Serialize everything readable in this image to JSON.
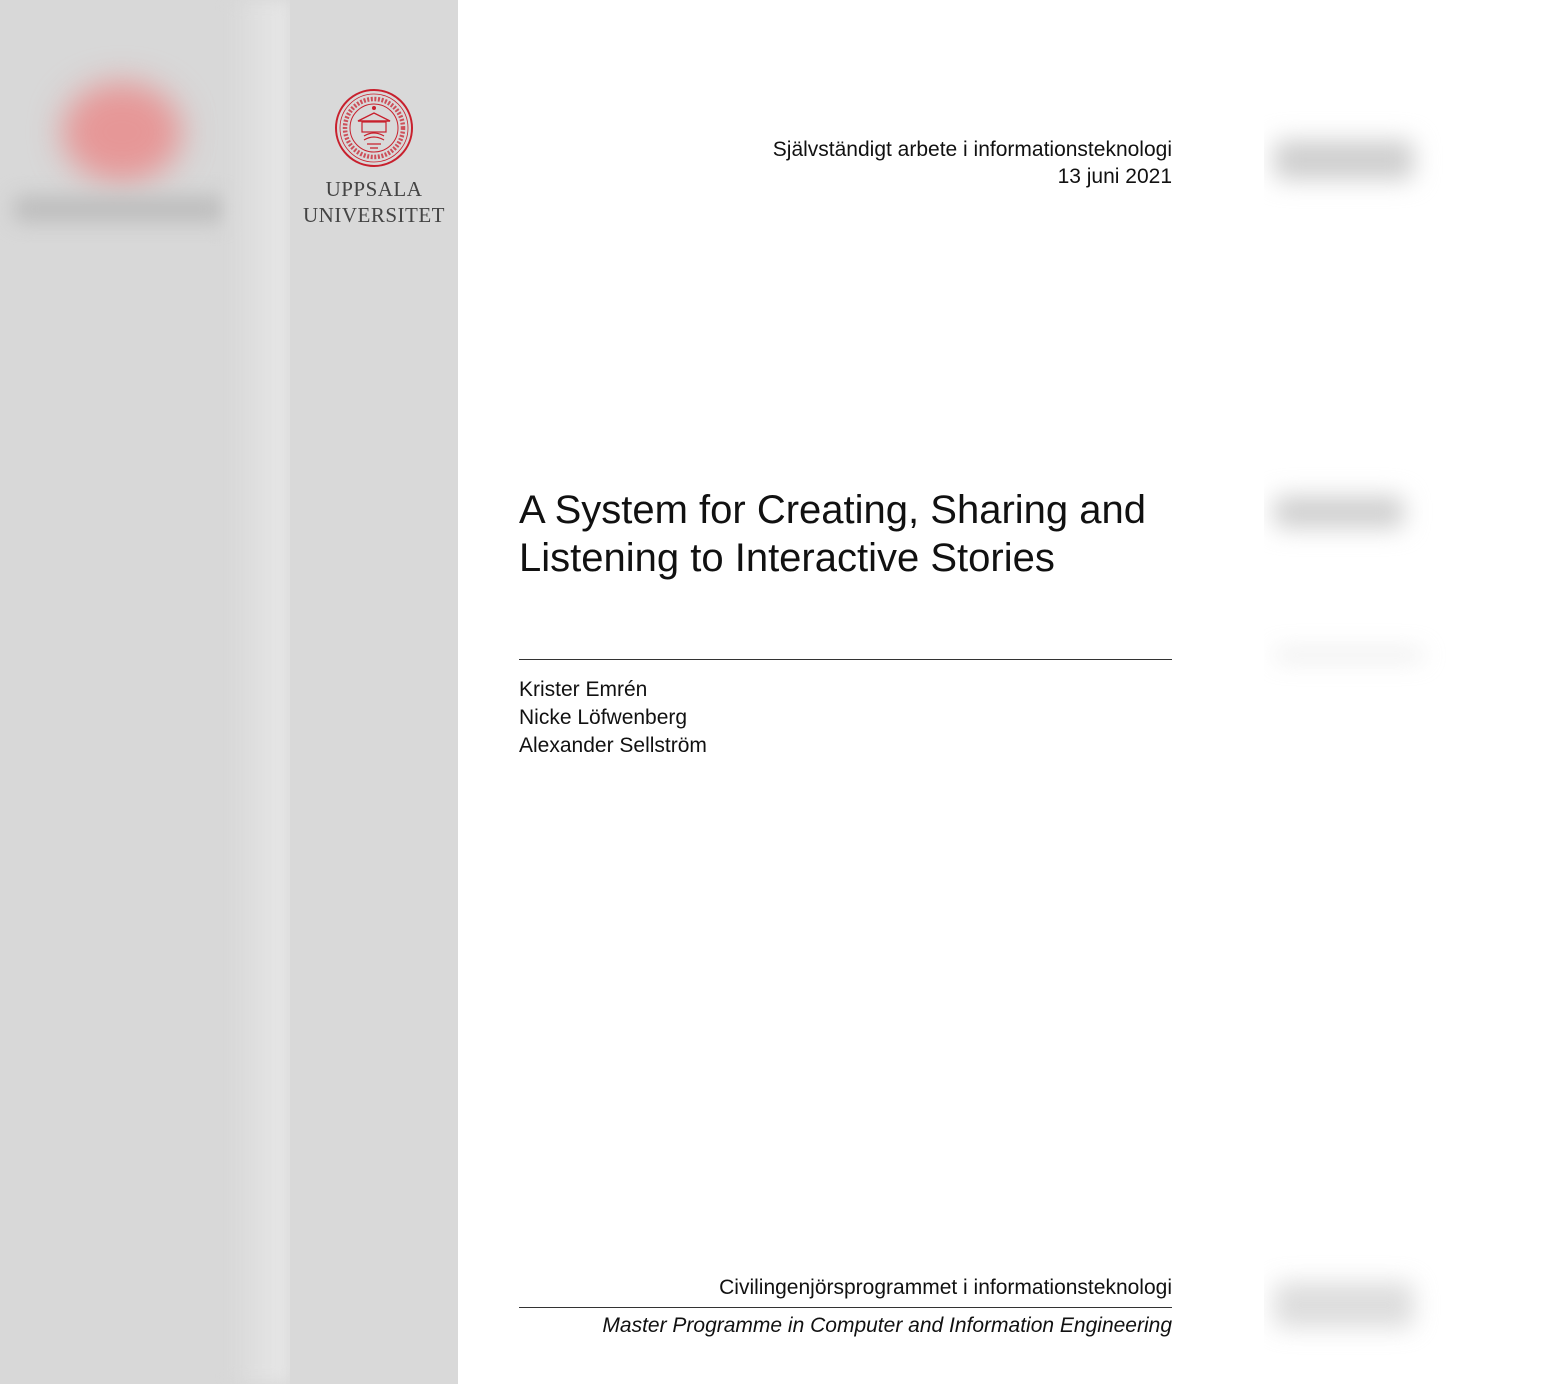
{
  "university": {
    "name_line1": "UPPSALA",
    "name_line2": "UNIVERSITET",
    "seal_text": "SIGILLUM UNIVERSITATIS UPSALIENSIS ACADEMICAE"
  },
  "header": {
    "series": "Självständigt arbete i informationsteknologi",
    "date": "13 juni 2021"
  },
  "title": {
    "line1": "A System for Creating, Sharing and",
    "line2": "Listening to Interactive Stories"
  },
  "authors": [
    "Krister Emrén",
    "Nicke Löfwenberg",
    "Alexander Sellström"
  ],
  "programme": {
    "swedish": "Civilingenjörsprogrammet i informationsteknologi",
    "english": "Master Programme in Computer and Information Engineering"
  },
  "colors": {
    "seal_red": "#c8202d",
    "sidebar_gray": "#d9d9d9",
    "text": "#111111"
  }
}
